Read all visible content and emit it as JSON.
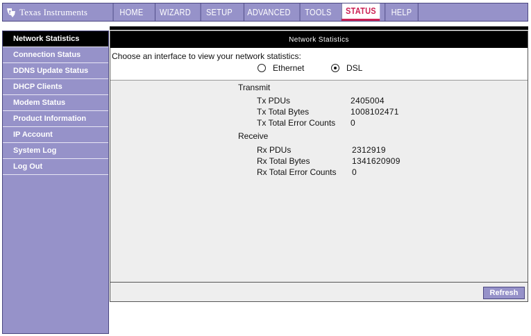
{
  "brand": {
    "name": "Texas Instruments",
    "accent": "#9692c9",
    "active_tab_color": "#cc2255"
  },
  "nav": {
    "tabs": [
      "HOME",
      "WIZARD",
      "SETUP",
      "ADVANCED",
      "TOOLS",
      "STATUS",
      "HELP"
    ],
    "active": "STATUS"
  },
  "sidebar": {
    "items": [
      "Network Statistics",
      "Connection Status",
      "DDNS Update Status",
      "DHCP Clients",
      "Modem Status",
      "Product Information",
      "IP Account",
      "System Log",
      "Log Out"
    ],
    "active": "Network Statistics"
  },
  "main": {
    "header": "Network Statistics",
    "prompt": "Choose an interface to view your network statistics:",
    "interfaces": [
      {
        "label": "Ethernet",
        "checked": false
      },
      {
        "label": "DSL",
        "checked": true
      }
    ],
    "transmit": {
      "title": "Transmit",
      "rows": [
        {
          "label": "Tx PDUs",
          "value": "2405004"
        },
        {
          "label": "Tx Total Bytes",
          "value": "1008102471"
        },
        {
          "label": "Tx Total Error Counts",
          "value": "0"
        }
      ]
    },
    "receive": {
      "title": "Receive",
      "rows": [
        {
          "label": "Rx PDUs",
          "value": "2312919"
        },
        {
          "label": "Rx Total Bytes",
          "value": "1341620909"
        },
        {
          "label": "Rx Total Error Counts",
          "value": "0"
        }
      ]
    },
    "refresh_label": "Refresh"
  }
}
